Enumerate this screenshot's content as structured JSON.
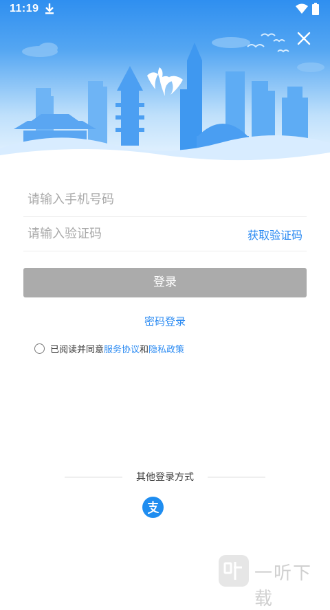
{
  "status_bar": {
    "time": "11:19",
    "download_icon": "download-icon",
    "wifi_icon": "wifi-icon",
    "battery_icon": "battery-icon"
  },
  "header": {
    "close_icon": "close-icon",
    "illustration": "city-skyline-illustration",
    "colors": {
      "sky_top": "#2f8ff0",
      "sky_bottom": "#eaf5ff",
      "buildings": "#5aa9f3"
    }
  },
  "form": {
    "phone_placeholder": "请输入手机号码",
    "code_placeholder": "请输入验证码",
    "get_code_label": "获取验证码",
    "login_label": "登录",
    "password_login_label": "密码登录"
  },
  "agreement": {
    "prefix": "已阅读并同意",
    "service_link": "服务协议",
    "joiner": "和",
    "privacy_link": "隐私政策",
    "checked": false
  },
  "other_login": {
    "title": "其他登录方式",
    "alipay_icon": "alipay-icon"
  },
  "watermark": {
    "text": "一听下载"
  },
  "colors": {
    "accent": "#2a8af2",
    "button_disabled": "#ababab",
    "divider": "#ececec"
  }
}
